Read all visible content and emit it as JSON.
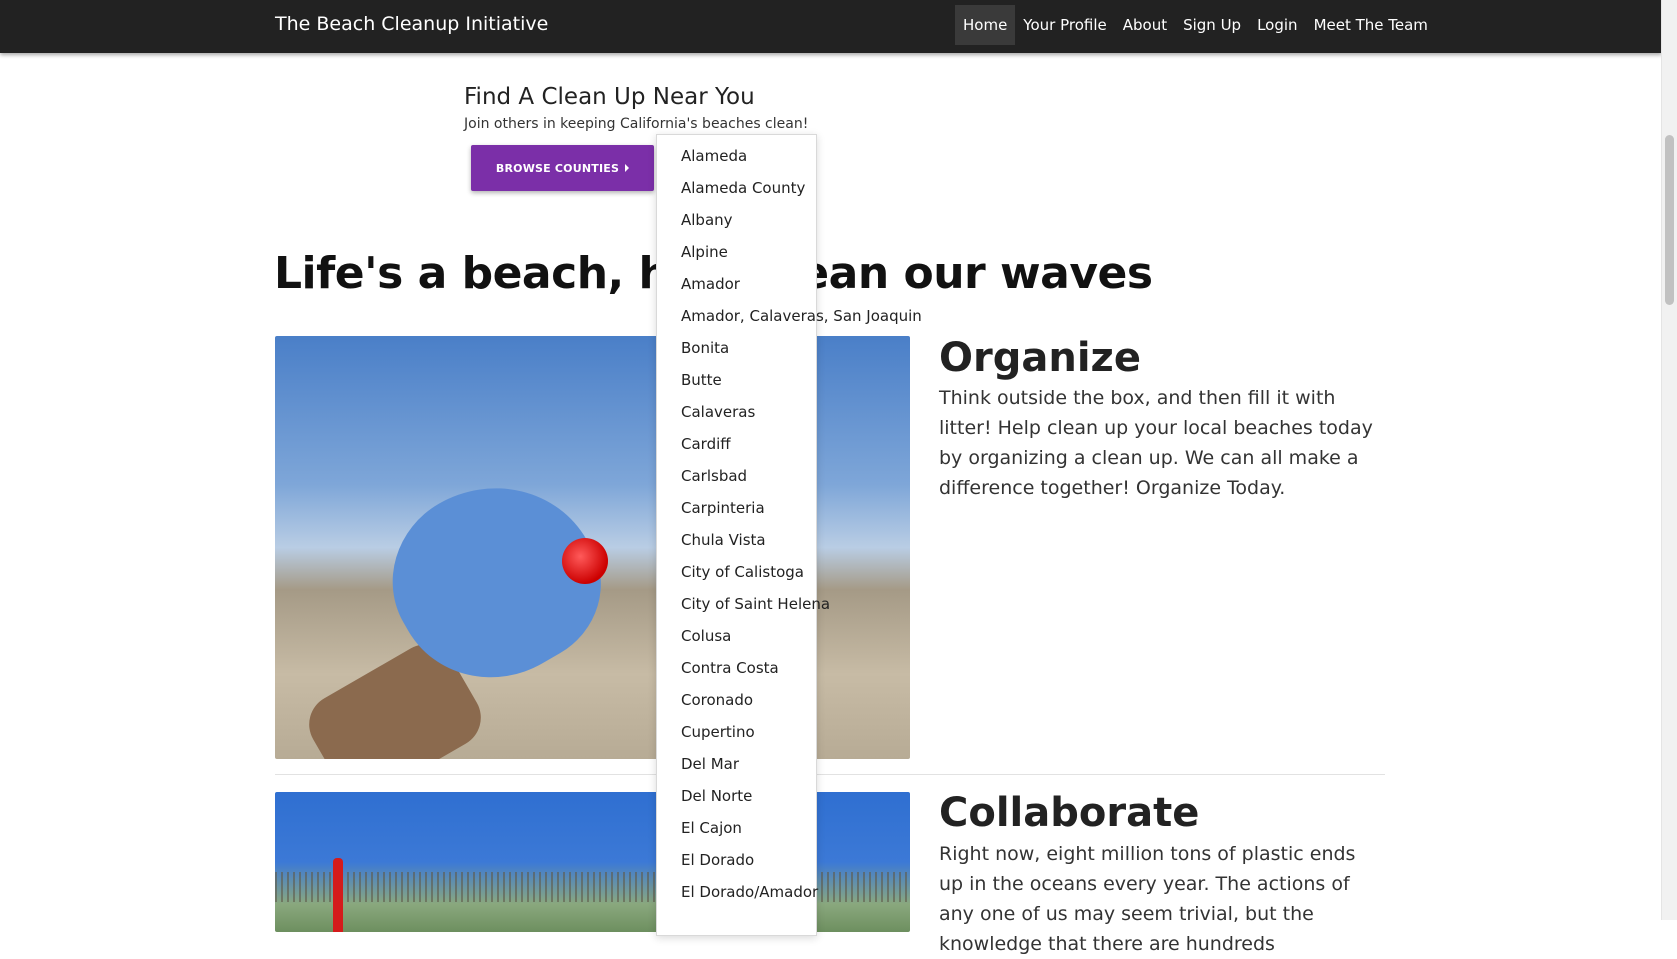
{
  "navbar": {
    "brand": "The Beach Cleanup Initiative",
    "links": [
      {
        "label": "Home",
        "active": true
      },
      {
        "label": "Your Profile"
      },
      {
        "label": "About"
      },
      {
        "label": "Sign Up"
      },
      {
        "label": "Login"
      },
      {
        "label": "Meet The Team"
      }
    ]
  },
  "find": {
    "title": "Find A Clean Up Near You",
    "subtitle": "Join others in keeping California's beaches clean!",
    "browse_label": "BROWSE COUNTIES"
  },
  "headline": "Life's a beach, help clean our waves",
  "sections": [
    {
      "title": "Organize",
      "body": "Think outside the box, and then fill it with litter! Help clean up your local beaches today by organizing a clean up. We can all make a difference together! Organize Today."
    },
    {
      "title": "Collaborate",
      "body": "Right now, eight million tons of plastic ends up in the oceans every year. The actions of any one of us may seem trivial, but the knowledge that there are hundreds"
    }
  ],
  "counties": [
    "Alameda",
    "Alameda County",
    "Albany",
    "Alpine",
    "Amador",
    "Amador, Calaveras, San Joaquin",
    "Bonita",
    "Butte",
    "Calaveras",
    "Cardiff",
    "Carlsbad",
    "Carpinteria",
    "Chula Vista",
    "City of Calistoga",
    "City of Saint Helena",
    "Colusa",
    "Contra Costa",
    "Coronado",
    "Cupertino",
    "Del Mar",
    "Del Norte",
    "El Cajon",
    "El Dorado",
    "El Dorado/Amador"
  ],
  "colors": {
    "navbar_bg": "#222222",
    "button_purple": "#7b2fa8"
  }
}
